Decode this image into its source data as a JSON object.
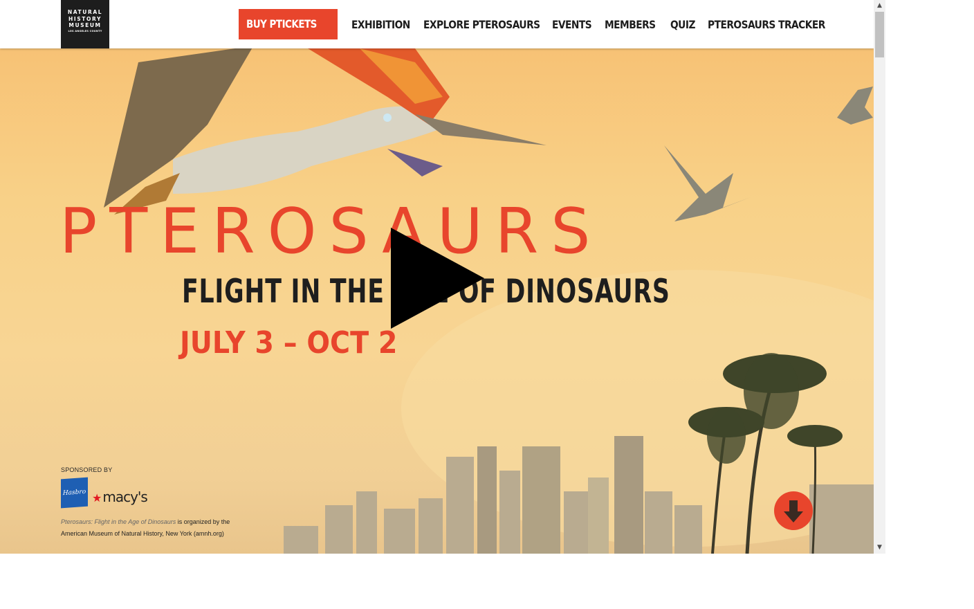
{
  "header": {
    "logo": {
      "line1": "NATURAL",
      "line2": "HISTORY",
      "line3": "MUSEUM",
      "line4": "LOS ANGELES COUNTY"
    },
    "nav": [
      {
        "label": "BUY PTICKETS"
      },
      {
        "label": "EXHIBITION"
      },
      {
        "label": "EXPLORE PTEROSAURS"
      },
      {
        "label": "EVENTS"
      },
      {
        "label": "MEMBERS"
      },
      {
        "label": "QUIZ"
      },
      {
        "label": "PTEROSAURS TRACKER"
      }
    ]
  },
  "hero": {
    "title": "PTEROSAURS",
    "subtitle": "FLIGHT IN THE AGE OF DINOSAURS",
    "dates": "JULY 3 – OCT 2",
    "play_icon": "play-icon",
    "sponsor": {
      "label": "SPONSORED BY",
      "sponsors": [
        "Hasbro",
        "macy's"
      ]
    },
    "credit": {
      "italic": "Pterosaurs: Flight in the Age of Dinosaurs",
      "rest": " is organized by the American Museum of Natural History, New York (amnh.org)"
    },
    "scroll_icon": "arrow-down-icon"
  },
  "colors": {
    "accent": "#e8452c",
    "dark": "#1d1d1d",
    "sky": "#f8d594"
  }
}
